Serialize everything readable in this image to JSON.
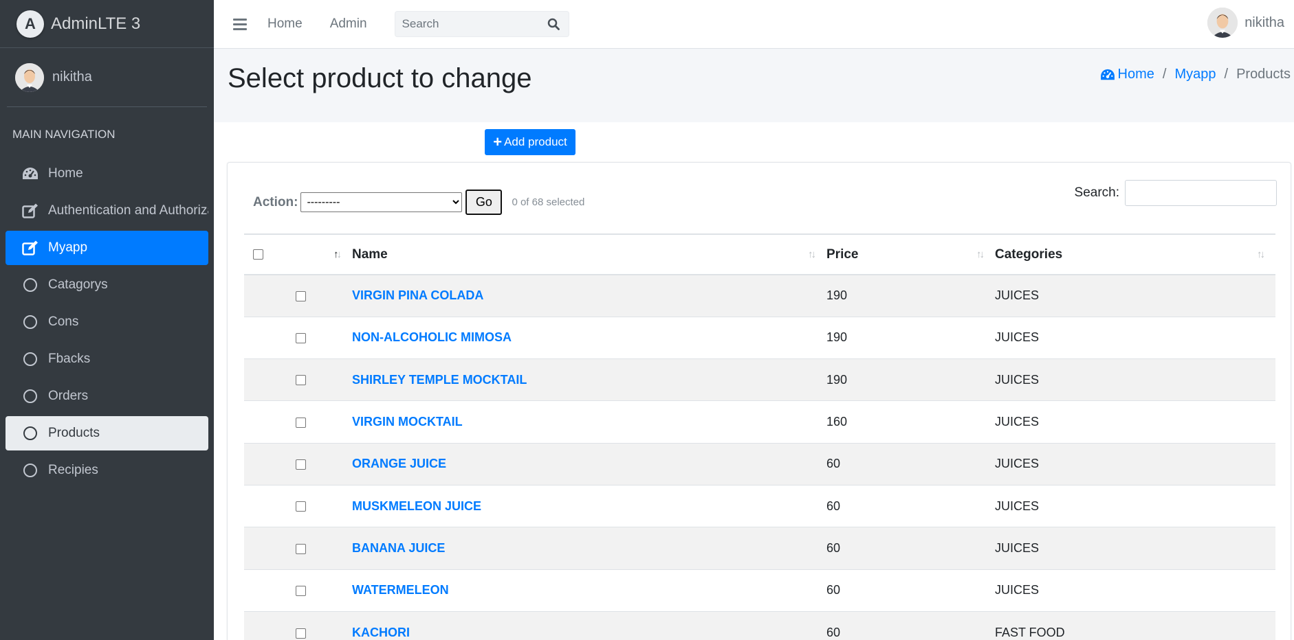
{
  "brand": {
    "title": "AdminLTE 3",
    "logo_letter": "A"
  },
  "sidebar": {
    "user": "nikitha",
    "header": "MAIN NAVIGATION",
    "items": [
      {
        "label": "Home",
        "icon": "tachometer-icon"
      },
      {
        "label": "Authentication and Authorization",
        "icon": "edit-icon"
      },
      {
        "label": "Myapp",
        "icon": "edit-icon",
        "state": "active"
      },
      {
        "label": "Catagorys",
        "icon": "circle-icon"
      },
      {
        "label": "Cons",
        "icon": "circle-icon"
      },
      {
        "label": "Fbacks",
        "icon": "circle-icon"
      },
      {
        "label": "Orders",
        "icon": "circle-icon"
      },
      {
        "label": "Products",
        "icon": "circle-icon",
        "state": "selected"
      },
      {
        "label": "Recipies",
        "icon": "circle-icon"
      }
    ]
  },
  "topbar": {
    "links": [
      "Home",
      "Admin"
    ],
    "search_placeholder": "Search",
    "user": "nikitha"
  },
  "page": {
    "title": "Select product to change",
    "breadcrumb": [
      "Home",
      "Myapp",
      "Products"
    ],
    "add_button": "Add product"
  },
  "changelist": {
    "action_label": "Action:",
    "action_value": "---------",
    "go_label": "Go",
    "selected_text": "0 of 68 selected",
    "search_label": "Search:",
    "columns": [
      "Name",
      "Price",
      "Categories"
    ],
    "rows": [
      {
        "name": "VIRGIN PINA COLADA",
        "price": "190",
        "category": "JUICES"
      },
      {
        "name": "NON-ALCOHOLIC MIMOSA",
        "price": "190",
        "category": "JUICES"
      },
      {
        "name": "SHIRLEY TEMPLE MOCKTAIL",
        "price": "190",
        "category": "JUICES"
      },
      {
        "name": "VIRGIN MOCKTAIL",
        "price": "160",
        "category": "JUICES"
      },
      {
        "name": "ORANGE JUICE",
        "price": "60",
        "category": "JUICES"
      },
      {
        "name": "MUSKMELEON JUICE",
        "price": "60",
        "category": "JUICES"
      },
      {
        "name": "BANANA JUICE",
        "price": "60",
        "category": "JUICES"
      },
      {
        "name": "WATERMELEON",
        "price": "60",
        "category": "JUICES"
      },
      {
        "name": "KACHORI",
        "price": "60",
        "category": "FAST FOOD"
      }
    ]
  },
  "colors": {
    "primary": "#007bff",
    "sidebar": "#343a40"
  }
}
